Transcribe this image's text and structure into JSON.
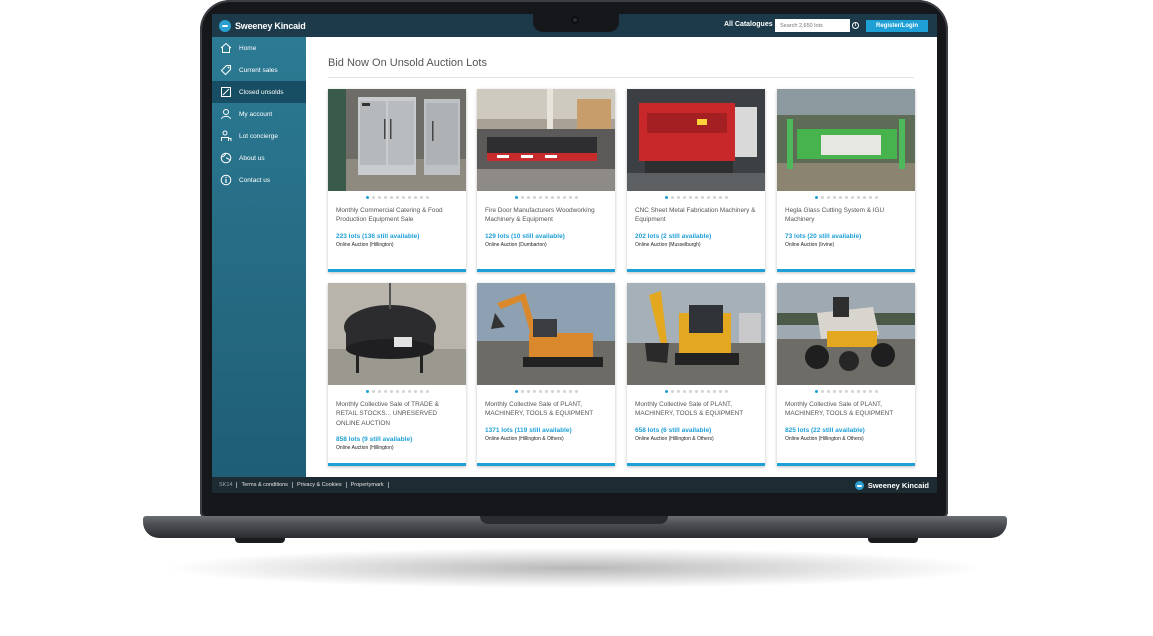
{
  "brand": {
    "name": "Sweeney Kincaid",
    "accent": "#1e9fd6",
    "sidebar": "#2c7a94",
    "topbar": "#1c3a4a"
  },
  "header": {
    "catalogues_label": "All Catalogues",
    "search_placeholder": "Search 2,650 lots",
    "register_label": "Register/Login"
  },
  "sidebar": {
    "items": [
      {
        "label": "Home",
        "icon": "home-icon"
      },
      {
        "label": "Current sales",
        "icon": "tag-icon"
      },
      {
        "label": "Closed unsolds",
        "icon": "edit-icon"
      },
      {
        "label": "My account",
        "icon": "user-icon"
      },
      {
        "label": "Lot concierge",
        "icon": "concierge-icon"
      },
      {
        "label": "About us",
        "icon": "globe-icon"
      },
      {
        "label": "Contact us",
        "icon": "info-icon"
      }
    ]
  },
  "main": {
    "title": "Bid Now On Unsold Auction Lots",
    "cards": [
      {
        "title": "Monthly Commercial Catering & Food Production Equipment Sale",
        "lots": "223 lots (136 still available)",
        "type": "Online Auction (Hillington)"
      },
      {
        "title": "Fire Door Manufacturers Woodworking Machinery & Equipment",
        "lots": "129 lots (10 still available)",
        "type": "Online Auction (Dumbarton)"
      },
      {
        "title": "CNC Sheet Metal Fabrication Machinery & Equipment",
        "lots": "202 lots (2 still available)",
        "type": "Online Auction (Musselburgh)"
      },
      {
        "title": "Hegla Glass Cutting System & IGU Machinery",
        "lots": "73 lots (20 still available)",
        "type": "Online Auction (Irvine)"
      },
      {
        "title": "Monthly Collective Sale of TRADE & RETAIL STOCKS... UNRESERVED ONLINE AUCTION",
        "lots": "858 lots (9 still available)",
        "type": "Online Auction (Hillington)"
      },
      {
        "title": "Monthly Collective Sale of PLANT, MACHINERY, TOOLS & EQUIPMENT",
        "lots": "1371 lots (119 still available)",
        "type": "Online Auction (Hillington & Others)"
      },
      {
        "title": "Monthly Collective Sale of PLANT, MACHINERY, TOOLS & EQUIPMENT",
        "lots": "658 lots (6 still available)",
        "type": "Online Auction (Hillington & Others)"
      },
      {
        "title": "Monthly Collective Sale of PLANT, MACHINERY, TOOLS & EQUIPMENT",
        "lots": "825 lots (22 still available)",
        "type": "Online Auction (Hillington & Others)"
      }
    ]
  },
  "footer": {
    "code": "SK14",
    "links": [
      "Terms & conditions",
      "Privacy & Cookies",
      "Propertymark"
    ],
    "brand": "Sweeney Kincaid"
  }
}
